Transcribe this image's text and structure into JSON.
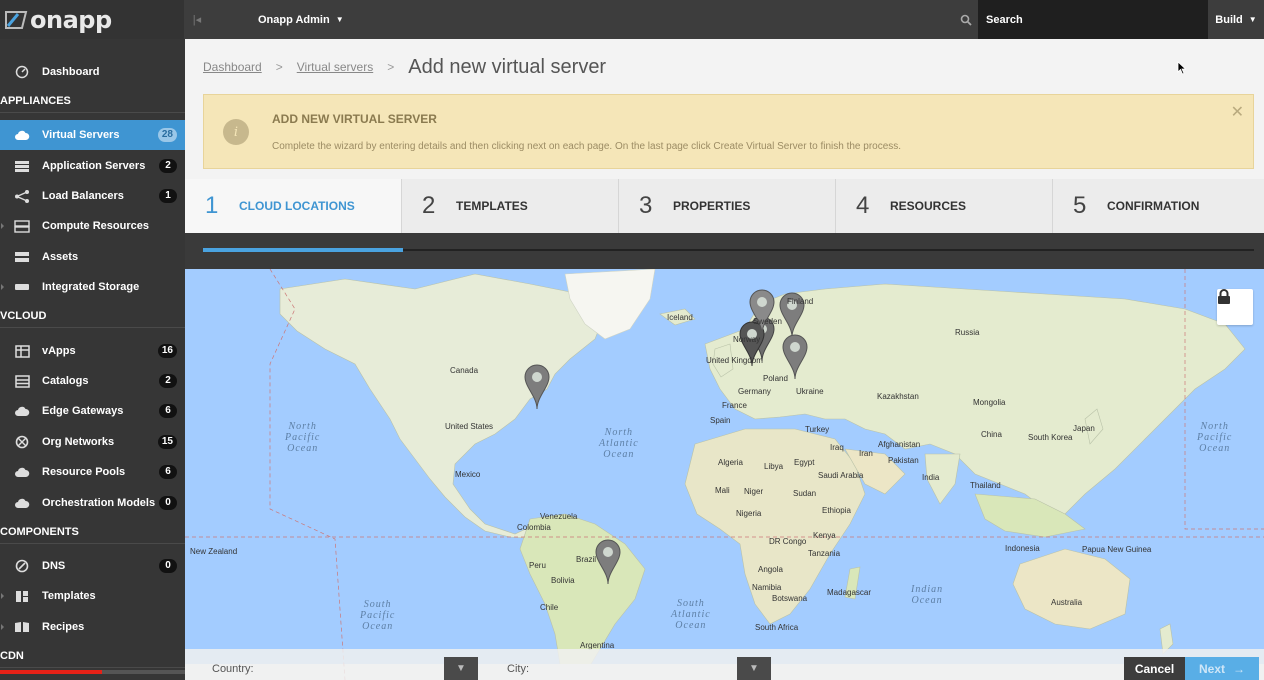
{
  "topbar": {
    "logo_text": "onapp",
    "user_label": "Onapp Admin",
    "search_label": "Search",
    "build_label": "Build"
  },
  "sidebar": {
    "dashboard": "Dashboard",
    "appliances_title": "APPLIANCES",
    "appliances": [
      {
        "label": "Virtual Servers",
        "count": "28",
        "icon": "cloud-icon"
      },
      {
        "label": "Application Servers",
        "count": "2",
        "icon": "server-stack-icon"
      },
      {
        "label": "Load Balancers",
        "count": "1",
        "icon": "load-balancer-icon"
      },
      {
        "label": "Compute Resources",
        "icon": "compute-icon"
      },
      {
        "label": "Assets",
        "icon": "assets-icon"
      },
      {
        "label": "Integrated Storage",
        "icon": "storage-icon"
      }
    ],
    "vcloud_title": "VCLOUD",
    "vcloud": [
      {
        "label": "vApps",
        "count": "16",
        "icon": "vapps-icon"
      },
      {
        "label": "Catalogs",
        "count": "2",
        "icon": "catalogs-icon"
      },
      {
        "label": "Edge Gateways",
        "count": "6",
        "icon": "edge-gateway-icon"
      },
      {
        "label": "Org Networks",
        "count": "15",
        "icon": "network-icon"
      },
      {
        "label": "Resource Pools",
        "count": "6",
        "icon": "resource-pool-icon"
      },
      {
        "label": "Orchestration Models",
        "count": "0",
        "icon": "orchestration-icon"
      }
    ],
    "components_title": "COMPONENTS",
    "components": [
      {
        "label": "DNS",
        "count": "0",
        "icon": "dns-icon"
      },
      {
        "label": "Templates",
        "icon": "templates-icon"
      },
      {
        "label": "Recipes",
        "icon": "recipes-icon"
      }
    ],
    "cdn_title": "CDN",
    "video_progress": 0.55
  },
  "breadcrumb": {
    "items": [
      "Dashboard",
      "Virtual servers"
    ],
    "title": "Add new virtual server"
  },
  "alert": {
    "title": "ADD NEW VIRTUAL SERVER",
    "message": "Complete the wizard by entering details and then clicking next on each page. On the last page click Create Virtual Server to finish the process."
  },
  "wizard": {
    "steps": [
      {
        "num": "1",
        "name": "CLOUD LOCATIONS"
      },
      {
        "num": "2",
        "name": "TEMPLATES"
      },
      {
        "num": "3",
        "name": "PROPERTIES"
      },
      {
        "num": "4",
        "name": "RESOURCES"
      },
      {
        "num": "5",
        "name": "CONFIRMATION"
      }
    ],
    "active_step": 1,
    "progress": 0.19
  },
  "map": {
    "countries": [
      "Finland",
      "Sweden",
      "Norway",
      "Iceland",
      "Russia",
      "United Kingdom",
      "Poland",
      "Germany",
      "Ukraine",
      "France",
      "Spain",
      "Kazakhstan",
      "Mongolia",
      "Canada",
      "United States",
      "Turkey",
      "Afghanistan",
      "China",
      "South Korea",
      "Japan",
      "Iraq",
      "Iran",
      "Pakistan",
      "Algeria",
      "Libya",
      "Egypt",
      "Saudi Arabia",
      "India",
      "Mexico",
      "Thailand",
      "Mali",
      "Niger",
      "Sudan",
      "Nigeria",
      "Ethiopia",
      "Venezuela",
      "Colombia",
      "Kenya",
      "DR Congo",
      "Tanzania",
      "Indonesia",
      "Papua New Guinea",
      "Brazil",
      "Peru",
      "Bolivia",
      "Angola",
      "Namibia",
      "Botswana",
      "Madagascar",
      "Chile",
      "South Africa",
      "Australia",
      "Argentina",
      "New Zealand",
      "Uni King"
    ],
    "oceans": {
      "north_pacific_left": "North\nPacific\nOcean",
      "north_atlantic": "North\nAtlantic\nOcean",
      "north_pacific_right": "North\nPacific\nOcean",
      "south_pacific": "South\nPacific\nOcean",
      "south_atlantic": "South\nAtlantic\nOcean",
      "indian": "Indian\nOcean"
    }
  },
  "filters": {
    "country_label": "Country:",
    "city_label": "City:",
    "cancel_label": "Cancel",
    "next_label": "Next"
  }
}
